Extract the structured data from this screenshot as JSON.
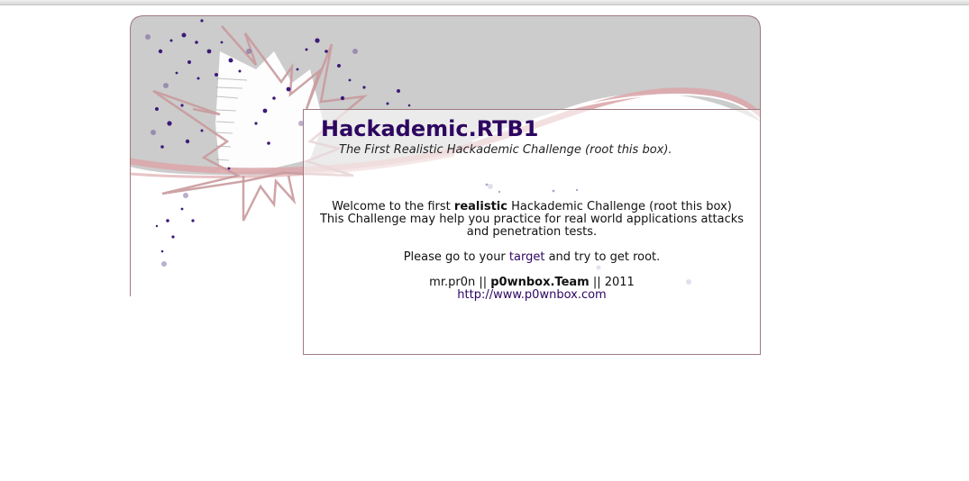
{
  "header": {
    "title": "Hackademic.RTB1",
    "subtitle": "The First Realistic Hackademic Challenge (root this box)."
  },
  "welcome": {
    "prefix": "Welcome to the first ",
    "bold": "realistic",
    "suffix": " Hackademic Challenge (root this box)",
    "line2": "This Challenge may help you practice for real world applications attacks",
    "line3": "and penetration tests."
  },
  "goto": {
    "prefix": "Please go to your ",
    "link": "target",
    "suffix": " and try to get root."
  },
  "credits": {
    "author": "mr.pr0n",
    "sep1": " || ",
    "team": "p0wnbox.Team",
    "sep2": " || ",
    "year": "2011",
    "url": "http://www.p0wnbox.com"
  },
  "colors": {
    "title": "#2d0660",
    "link": "#2d0660",
    "border": "#a07a80",
    "grey_banner": "#cccccc",
    "swoosh": "#dba8ac",
    "dots": "#3d1a78"
  }
}
